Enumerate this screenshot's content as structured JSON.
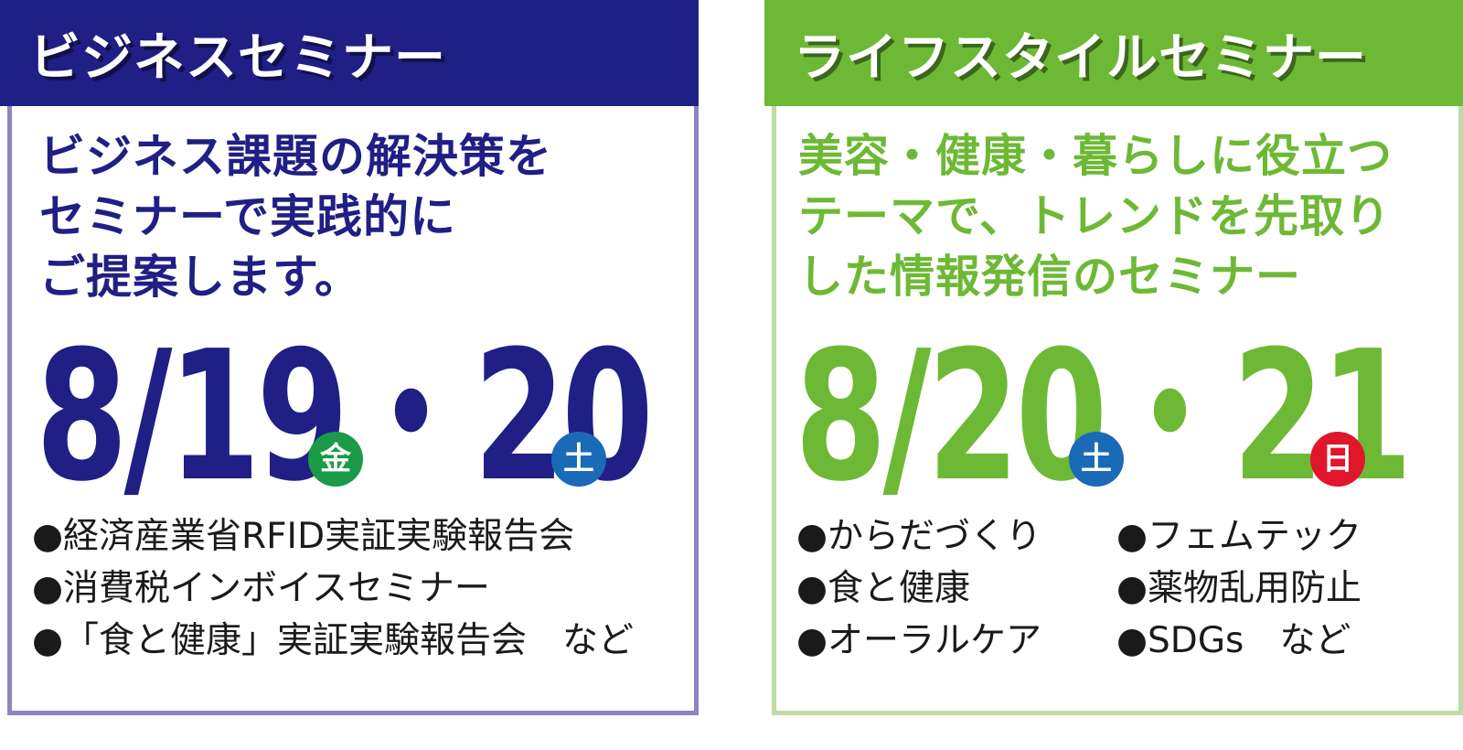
{
  "colors": {
    "business_accent": "#1f1f85",
    "lifestyle_accent": "#6db935",
    "badge_fri": "#1b9a47",
    "badge_sat": "#1a6ab8",
    "badge_sun": "#e0162b"
  },
  "business": {
    "title": "ビジネスセミナー",
    "lead_lines": [
      "ビジネス課題の解決策を",
      "セミナーで実践的に",
      "ご提案します。"
    ],
    "date_1": "8/19",
    "date_1_day": "金",
    "separator": "・",
    "date_2": "20",
    "date_2_day": "土",
    "topics": [
      "●経済産業省RFID実証実験報告会",
      "●消費税インボイスセミナー",
      "●「食と健康」実証実験報告会　など"
    ]
  },
  "lifestyle": {
    "title": "ライフスタイルセミナー",
    "lead_lines": [
      "美容・健康・暮らしに役立つ",
      "テーマで、トレンドを先取り",
      "した情報発信のセミナー"
    ],
    "date_1": "8/20",
    "date_1_day": "土",
    "separator": "・",
    "date_2": "21",
    "date_2_day": "日",
    "topics_left": [
      "●からだづくり",
      "●食と健康",
      "●オーラルケア"
    ],
    "topics_right": [
      "●フェムテック",
      "●薬物乱用防止",
      "●SDGs　など"
    ]
  }
}
